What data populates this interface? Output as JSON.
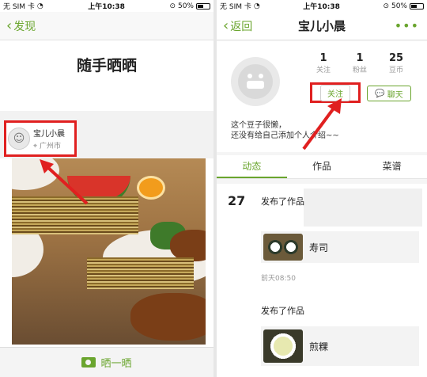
{
  "left": {
    "status": {
      "carrier": "无 SIM 卡",
      "time": "上午10:38",
      "battery": "50%"
    },
    "nav": {
      "back_label": "发现"
    },
    "title": "随手晒晒",
    "user": {
      "name": "宝儿小晨",
      "location": "广州市"
    },
    "bottom": {
      "share_label": "晒一晒",
      "icon": "camera-icon"
    }
  },
  "right": {
    "status": {
      "carrier": "无 SIM 卡",
      "time": "上午10:38",
      "battery": "50%"
    },
    "nav": {
      "back_label": "返回",
      "title": "宝儿小晨",
      "more_label": "•••"
    },
    "stats": [
      {
        "value": "1",
        "label": "关注"
      },
      {
        "value": "1",
        "label": "粉丝"
      },
      {
        "value": "25",
        "label": "豆币"
      }
    ],
    "buttons": {
      "follow_label": "关注",
      "chat_label": "聊天"
    },
    "intro": {
      "line1": "这个豆子很懒，",
      "line2": "还没有给自己添加个人介绍~~"
    },
    "tabs": [
      {
        "label": "动态"
      },
      {
        "label": "作品"
      },
      {
        "label": "菜谱"
      }
    ],
    "feed": {
      "date": "27",
      "posts": [
        {
          "text": "发布了作品",
          "work": "寿司",
          "time": "前天08:50"
        },
        {
          "text": "发布了作品",
          "work": "煎粿"
        }
      ]
    }
  },
  "colors": {
    "accent": "#6aa52e",
    "highlight": "#e02020"
  }
}
